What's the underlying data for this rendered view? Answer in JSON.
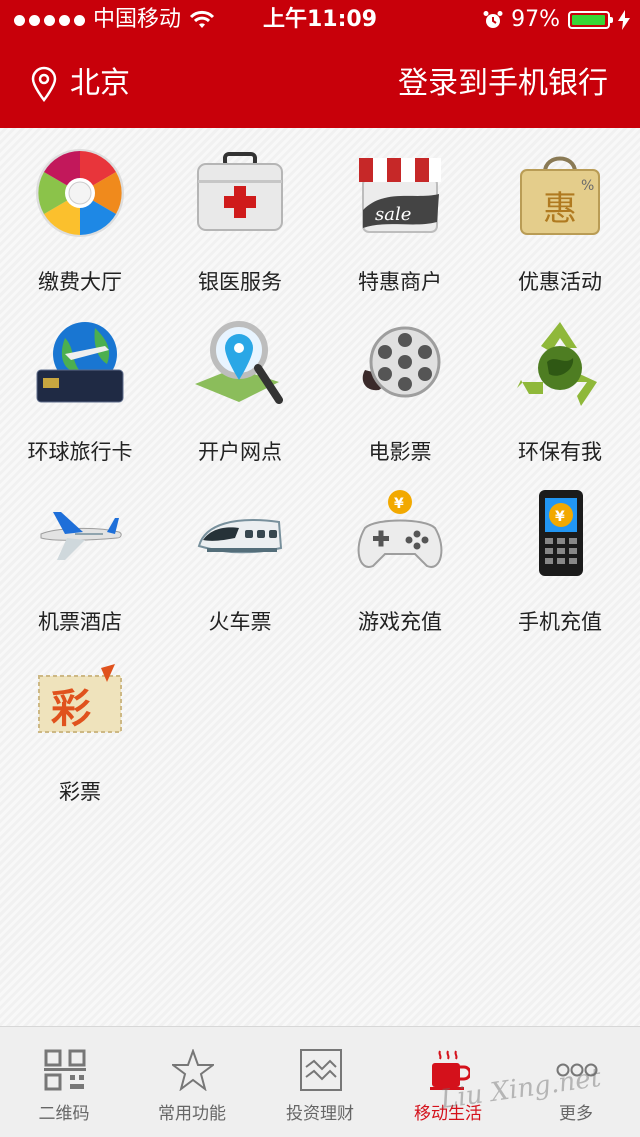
{
  "status_bar": {
    "carrier": "中国移动",
    "time": "上午11:09",
    "battery": "97%",
    "battery_level": 0.97
  },
  "header": {
    "location": "北京",
    "login": "登录到手机银行"
  },
  "grid": [
    {
      "label": "缴费大厅",
      "icon": "payment-wheel-icon"
    },
    {
      "label": "银医服务",
      "icon": "medical-kit-icon"
    },
    {
      "label": "特惠商户",
      "icon": "sale-shop-icon"
    },
    {
      "label": "优惠活动",
      "icon": "discount-bag-icon"
    },
    {
      "label": "环球旅行卡",
      "icon": "globe-card-icon"
    },
    {
      "label": "开户网点",
      "icon": "map-pin-magnifier-icon"
    },
    {
      "label": "电影票",
      "icon": "film-reel-icon"
    },
    {
      "label": "环保有我",
      "icon": "recycle-globe-icon"
    },
    {
      "label": "机票酒店",
      "icon": "airplane-icon"
    },
    {
      "label": "火车票",
      "icon": "bullet-train-icon"
    },
    {
      "label": "游戏充值",
      "icon": "gamepad-icon"
    },
    {
      "label": "手机充值",
      "icon": "phone-icon"
    },
    {
      "label": "彩票",
      "icon": "lottery-ticket-icon"
    }
  ],
  "tabbar": [
    {
      "label": "二维码",
      "icon": "qr-code-icon"
    },
    {
      "label": "常用功能",
      "icon": "star-icon"
    },
    {
      "label": "投资理财",
      "icon": "chart-icon"
    },
    {
      "label": "移动生活",
      "icon": "coffee-cup-icon",
      "active": true
    },
    {
      "label": "更多",
      "icon": "more-dots-icon"
    }
  ],
  "watermark": "Liu Xing.net",
  "colors": {
    "brand_red": "#c8000a",
    "active_tab": "#d4111b"
  }
}
